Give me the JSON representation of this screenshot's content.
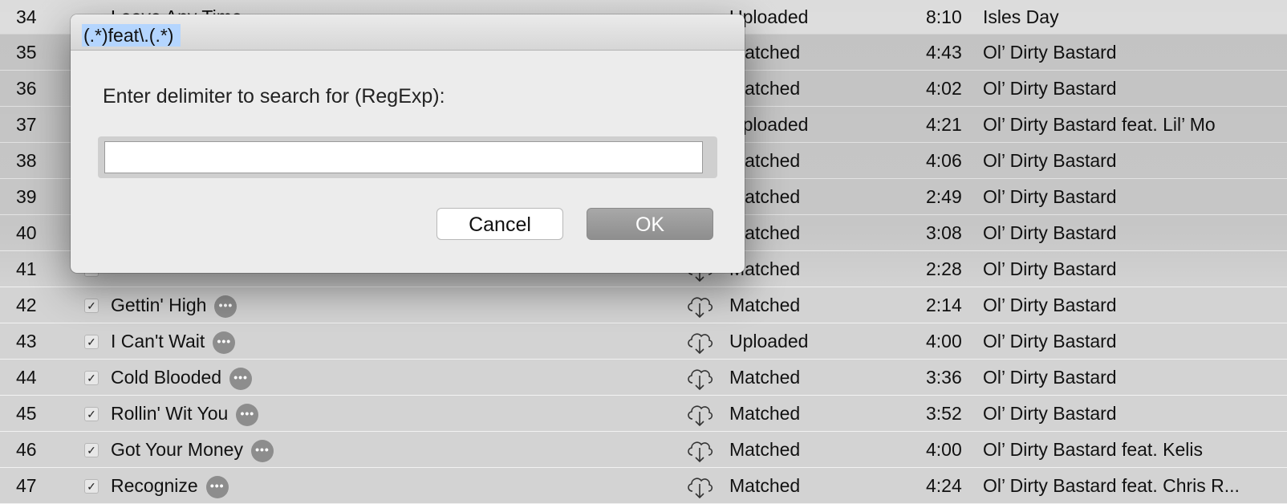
{
  "dialog": {
    "prompt": "Enter delimiter to search for (RegExp):",
    "input_value": "(.*)feat\\.(.*)",
    "cancel_label": "Cancel",
    "ok_label": "OK"
  },
  "tracks": [
    {
      "num": "34",
      "name": "Leave Any Time",
      "status": "Uploaded",
      "time": "8:10",
      "artist": "Isles Day"
    },
    {
      "num": "35",
      "name": "",
      "status": "Matched",
      "time": "4:43",
      "artist": "Ol’ Dirty Bastard"
    },
    {
      "num": "36",
      "name": "",
      "status": "Matched",
      "time": "4:02",
      "artist": "Ol’ Dirty Bastard"
    },
    {
      "num": "37",
      "name": "",
      "status": "Uploaded",
      "time": "4:21",
      "artist": "Ol’ Dirty Bastard feat. Lil’ Mo"
    },
    {
      "num": "38",
      "name": "",
      "status": "Matched",
      "time": "4:06",
      "artist": "Ol’ Dirty Bastard"
    },
    {
      "num": "39",
      "name": "",
      "status": "Matched",
      "time": "2:49",
      "artist": "Ol’ Dirty Bastard"
    },
    {
      "num": "40",
      "name": "",
      "status": "Matched",
      "time": "3:08",
      "artist": "Ol’ Dirty Bastard"
    },
    {
      "num": "41",
      "name": "",
      "status": "Matched",
      "time": "2:28",
      "artist": "Ol’ Dirty Bastard"
    },
    {
      "num": "42",
      "name": "Gettin' High",
      "status": "Matched",
      "time": "2:14",
      "artist": "Ol’ Dirty Bastard"
    },
    {
      "num": "43",
      "name": "I Can't Wait",
      "status": "Uploaded",
      "time": "4:00",
      "artist": "Ol’ Dirty Bastard"
    },
    {
      "num": "44",
      "name": "Cold Blooded",
      "status": "Matched",
      "time": "3:36",
      "artist": "Ol’ Dirty Bastard"
    },
    {
      "num": "45",
      "name": "Rollin' Wit You",
      "status": "Matched",
      "time": "3:52",
      "artist": "Ol’ Dirty Bastard"
    },
    {
      "num": "46",
      "name": "Got Your Money",
      "status": "Matched",
      "time": "4:00",
      "artist": "Ol’ Dirty Bastard feat. Kelis"
    },
    {
      "num": "47",
      "name": "Recognize",
      "status": "Matched",
      "time": "4:24",
      "artist": "Ol’ Dirty Bastard feat. Chris R..."
    }
  ],
  "icons": {
    "checkbox": "checkmark-icon",
    "more": "ellipsis-icon",
    "download": "cloud-download-icon"
  }
}
